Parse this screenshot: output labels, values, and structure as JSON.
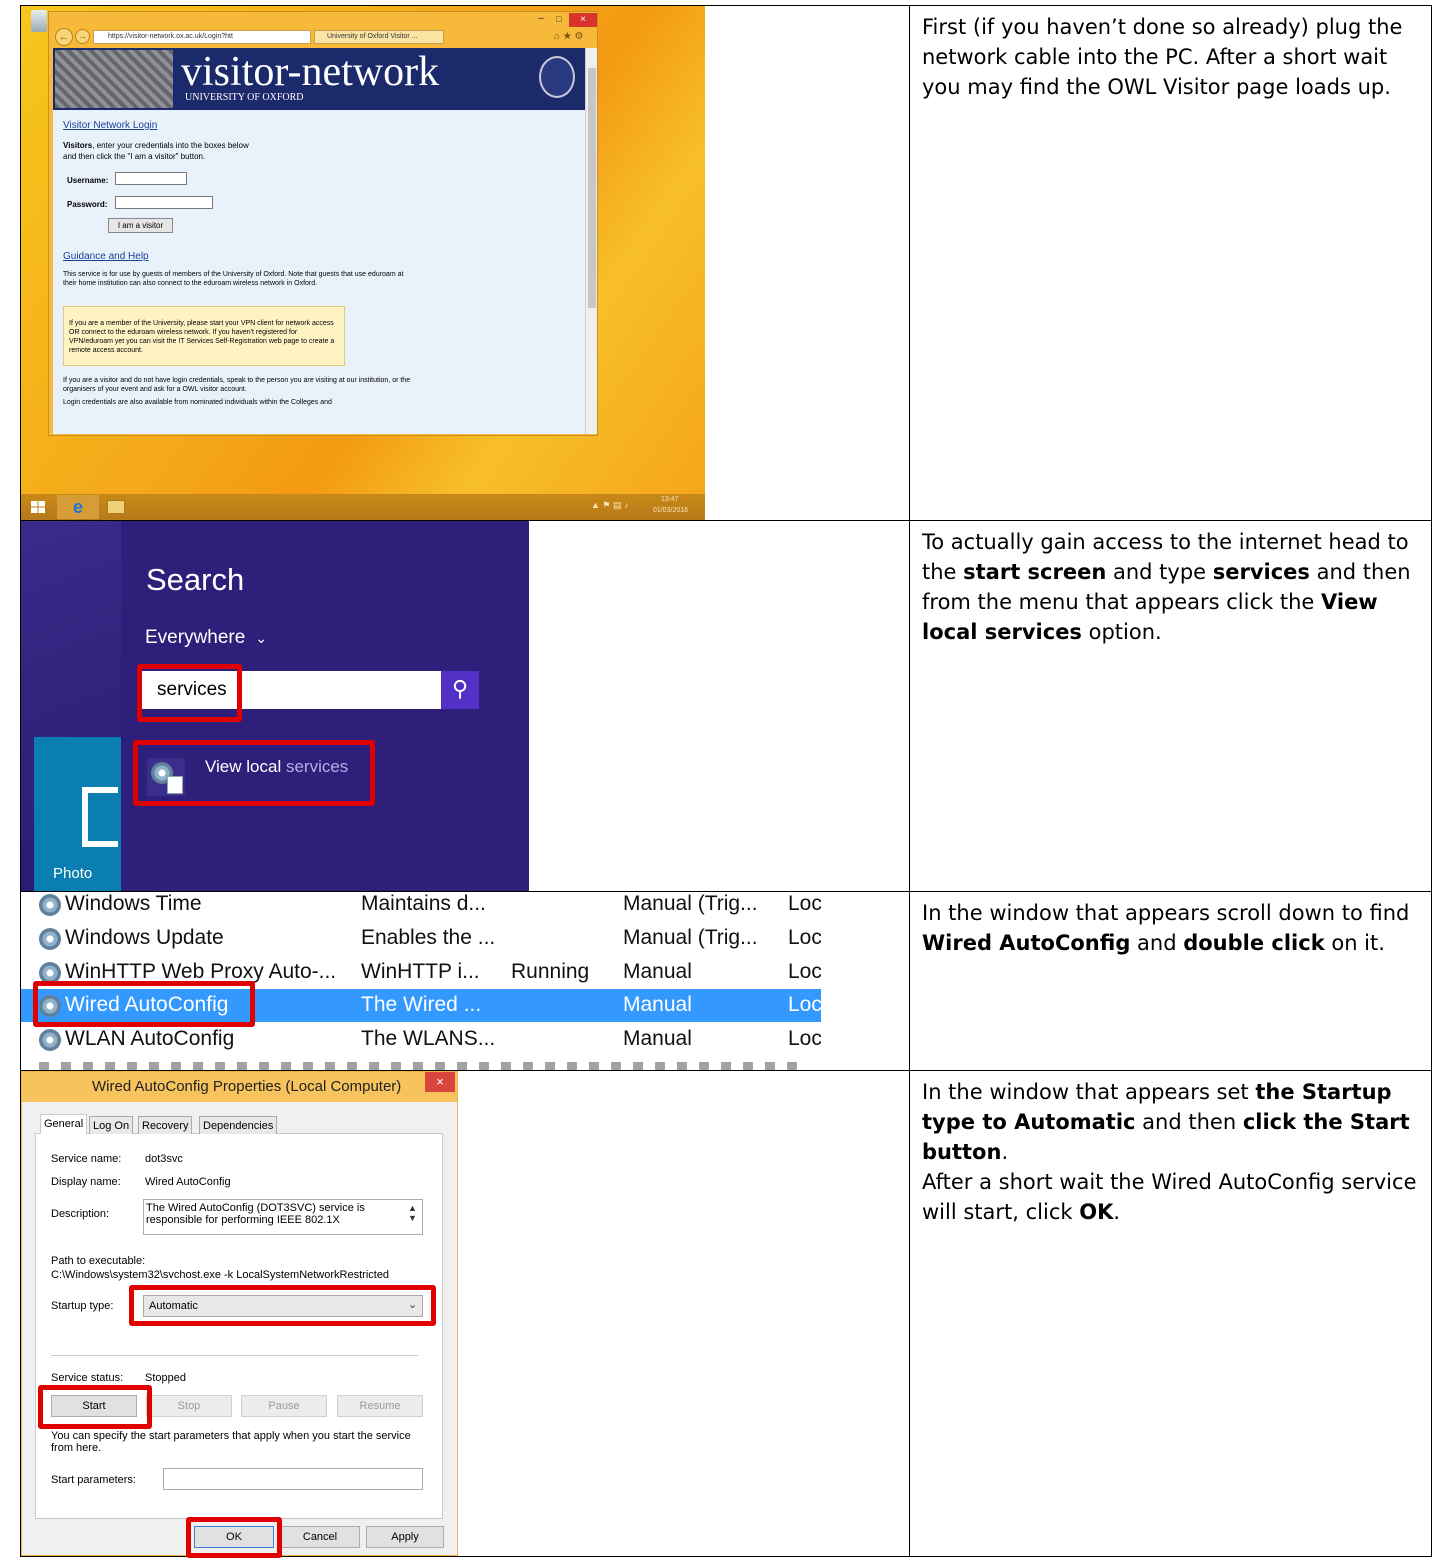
{
  "row1": {
    "text": "First (if you haven’t done so already) plug the network cable into the PC. After a short wait you may find the OWL Visitor page loads up.",
    "browser": {
      "url": "https://visitor-network.ox.ac.uk/Login?htt",
      "tab_title": "University of Oxford Visitor ...",
      "banner_title": "visitor-network",
      "banner_subtitle": "UNIVERSITY OF OXFORD",
      "login_heading": "Visitor Network Login",
      "visitors_bold": "Visitors",
      "visitors_text": ", enter your credentials into the boxes below and then click the \"I am a visitor\" button.",
      "username_label": "Username:",
      "password_label": "Password:",
      "visitor_button": "I am a visitor",
      "guidance_heading": "Guidance and Help",
      "guidance_text": "This service is for use by guests of members of the University of Oxford. Note that guests that use eduroam at their home institution can also connect to the eduroam wireless network in Oxford.",
      "member_note": "If you are a member of the University, please start your VPN client for network access OR connect to the eduroam wireless network. If you haven't registered for VPN/eduroam yet you can visit the IT Services Self-Registration web page to create a remote access account.",
      "visitor_note": "If you are a visitor and do not have login credentials, speak to the person you are visiting at our institution, or the organisers of your event and ask for a OWL visitor account.",
      "colleges_note": "Login credentials are also available from nominated individuals within the Colleges and"
    },
    "taskbar": {
      "time": "13:47",
      "date": "01/03/2016"
    }
  },
  "row2": {
    "text_parts": [
      "To actually gain access to the internet head to the ",
      "start screen",
      " and type ",
      "services",
      " and then from the menu that appears click the ",
      "View local services",
      " option."
    ],
    "search_title": "Search",
    "scope": "Everywhere",
    "query": "services",
    "result_prefix": "View local ",
    "result_suffix": "services",
    "tile_label": "Photo"
  },
  "row3": {
    "text_parts": [
      "In the window that appears scroll down to find ",
      "Wired AutoConfig",
      " and ",
      "double click",
      " on it."
    ],
    "services": [
      {
        "name": "Windows Time",
        "desc": "Maintains d...",
        "status": "",
        "startup": "Manual (Trig...",
        "logon": "Loc"
      },
      {
        "name": "Windows Update",
        "desc": "Enables the ...",
        "status": "",
        "startup": "Manual (Trig...",
        "logon": "Loc"
      },
      {
        "name": "WinHTTP Web Proxy Auto-...",
        "desc": "WinHTTP i...",
        "status": "Running",
        "startup": "Manual",
        "logon": "Loc"
      },
      {
        "name": "Wired AutoConfig",
        "desc": "The Wired ...",
        "status": "",
        "startup": "Manual",
        "logon": "Loc"
      },
      {
        "name": "WLAN AutoConfig",
        "desc": "The WLANS...",
        "status": "",
        "startup": "Manual",
        "logon": "Loc"
      }
    ]
  },
  "row4": {
    "text_parts": [
      "In the window that appears set ",
      "the Startup type to Automatic",
      " and then ",
      "click the Start button",
      "."
    ],
    "text2_parts": [
      "After a short wait the Wired AutoConfig service will start, click ",
      "OK",
      "."
    ],
    "dialog": {
      "title": "Wired AutoConfig Properties (Local Computer)",
      "tabs": [
        "General",
        "Log On",
        "Recovery",
        "Dependencies"
      ],
      "service_name_label": "Service name:",
      "service_name": "dot3svc",
      "display_name_label": "Display name:",
      "display_name": "Wired AutoConfig",
      "description_label": "Description:",
      "description": "The Wired AutoConfig (DOT3SVC) service is responsible for performing IEEE 802.1X",
      "path_label": "Path to executable:",
      "path": "C:\\Windows\\system32\\svchost.exe -k LocalSystemNetworkRestricted",
      "startup_label": "Startup type:",
      "startup_value": "Automatic",
      "status_label": "Service status:",
      "status_value": "Stopped",
      "start": "Start",
      "stop": "Stop",
      "pause": "Pause",
      "resume": "Resume",
      "params_note": "You can specify the start parameters that apply when you start the service from here.",
      "params_label": "Start parameters:",
      "ok": "OK",
      "cancel": "Cancel",
      "apply": "Apply"
    }
  }
}
